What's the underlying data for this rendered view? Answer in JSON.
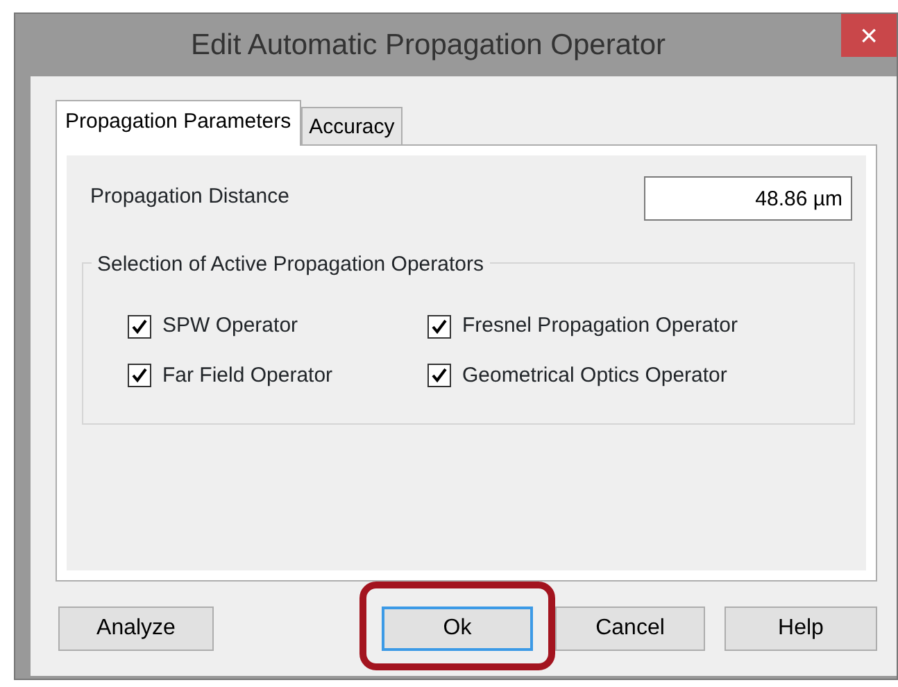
{
  "window": {
    "title": "Edit Automatic Propagation Operator",
    "close": "×"
  },
  "tabs": [
    {
      "label": "Propagation Parameters",
      "selected": true
    },
    {
      "label": "Accuracy",
      "selected": false
    }
  ],
  "distance": {
    "label": "Propagation Distance",
    "value": "48.86 µm"
  },
  "operators_group": {
    "title": "Selection of Active Propagation Operators",
    "items": [
      {
        "label": "SPW Operator",
        "checked": true
      },
      {
        "label": "Fresnel Propagation Operator",
        "checked": true
      },
      {
        "label": "Far Field Operator",
        "checked": true
      },
      {
        "label": "Geometrical Optics Operator",
        "checked": true
      }
    ]
  },
  "buttons": [
    {
      "label": "Analyze",
      "default": false,
      "highlighted": false
    },
    {
      "label": "Ok",
      "default": true,
      "highlighted": true
    },
    {
      "label": "Cancel",
      "default": false,
      "highlighted": false
    },
    {
      "label": "Help",
      "default": false,
      "highlighted": false
    }
  ]
}
